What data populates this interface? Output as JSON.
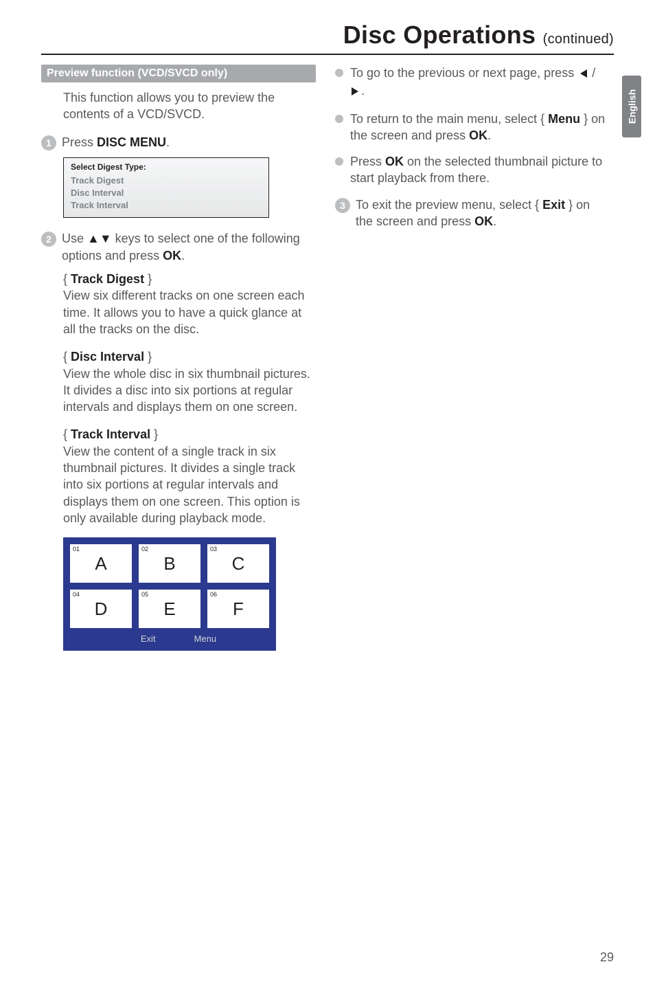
{
  "language_tab": "English",
  "heading": {
    "main": "Disc Operations ",
    "suffix": "(continued)"
  },
  "left": {
    "grey_bar": "Preview function (VCD/SVCD only)",
    "intro": "This function allows you to preview the contents of a VCD/SVCD.",
    "step1_num": "1",
    "step1_prefix": "Press ",
    "step1_bold": "DISC MENU",
    "step1_suffix": ".",
    "digest_box": {
      "label": "Select Digest Type:",
      "items": [
        "Track Digest",
        "Disc Interval",
        "Track Interval"
      ]
    },
    "step2_num": "2",
    "step2_text_a": "Use ",
    "step2_arrows": "▲▼",
    "step2_text_b": " keys to select one of the following options and press ",
    "step2_bold": "OK",
    "step2_suffix": ".",
    "opt1_title": "Track Digest",
    "opt1_body": "View six different tracks on one screen each time.  It allows you to have a quick glance at all the tracks on the disc.",
    "opt2_title": "Disc Interval",
    "opt2_body": "View the whole disc in six thumbnail pictures.  It divides a disc into six portions at regular intervals and displays them on one screen.",
    "opt3_title": "Track Interval",
    "opt3_body": "View the content of a single track in six thumbnail pictures.  It divides a single track into six portions at regular intervals and displays them on one screen. This option is only available during playback mode.",
    "thumbnails": [
      {
        "num": "01",
        "letter": "A"
      },
      {
        "num": "02",
        "letter": "B"
      },
      {
        "num": "03",
        "letter": "C"
      },
      {
        "num": "04",
        "letter": "D"
      },
      {
        "num": "05",
        "letter": "E"
      },
      {
        "num": "06",
        "letter": "F"
      }
    ],
    "thumb_footer": {
      "exit": "Exit",
      "menu": "Menu"
    }
  },
  "right": {
    "b1_a": "To go to the previous or next page, press ",
    "b1_icons_sep": " / ",
    "b1_end": ".",
    "b2_a": "To return to the main menu, select ",
    "b2_brace_open": "{ ",
    "b2_menu": "Menu",
    "b2_brace_close": " }",
    "b2_b": " on the screen and press ",
    "b2_ok": "OK",
    "b2_end": ".",
    "b3_a": "Press ",
    "b3_ok": "OK",
    "b3_b": " on the selected thumbnail picture to start playback from there.",
    "step3_num": "3",
    "step3_a": "To exit the preview menu, select ",
    "step3_brace_open": "{ ",
    "step3_exit": "Exit",
    "step3_brace_close": " }",
    "step3_b": " on the screen and press ",
    "step3_ok": "OK",
    "step3_end": "."
  },
  "page_number": "29"
}
